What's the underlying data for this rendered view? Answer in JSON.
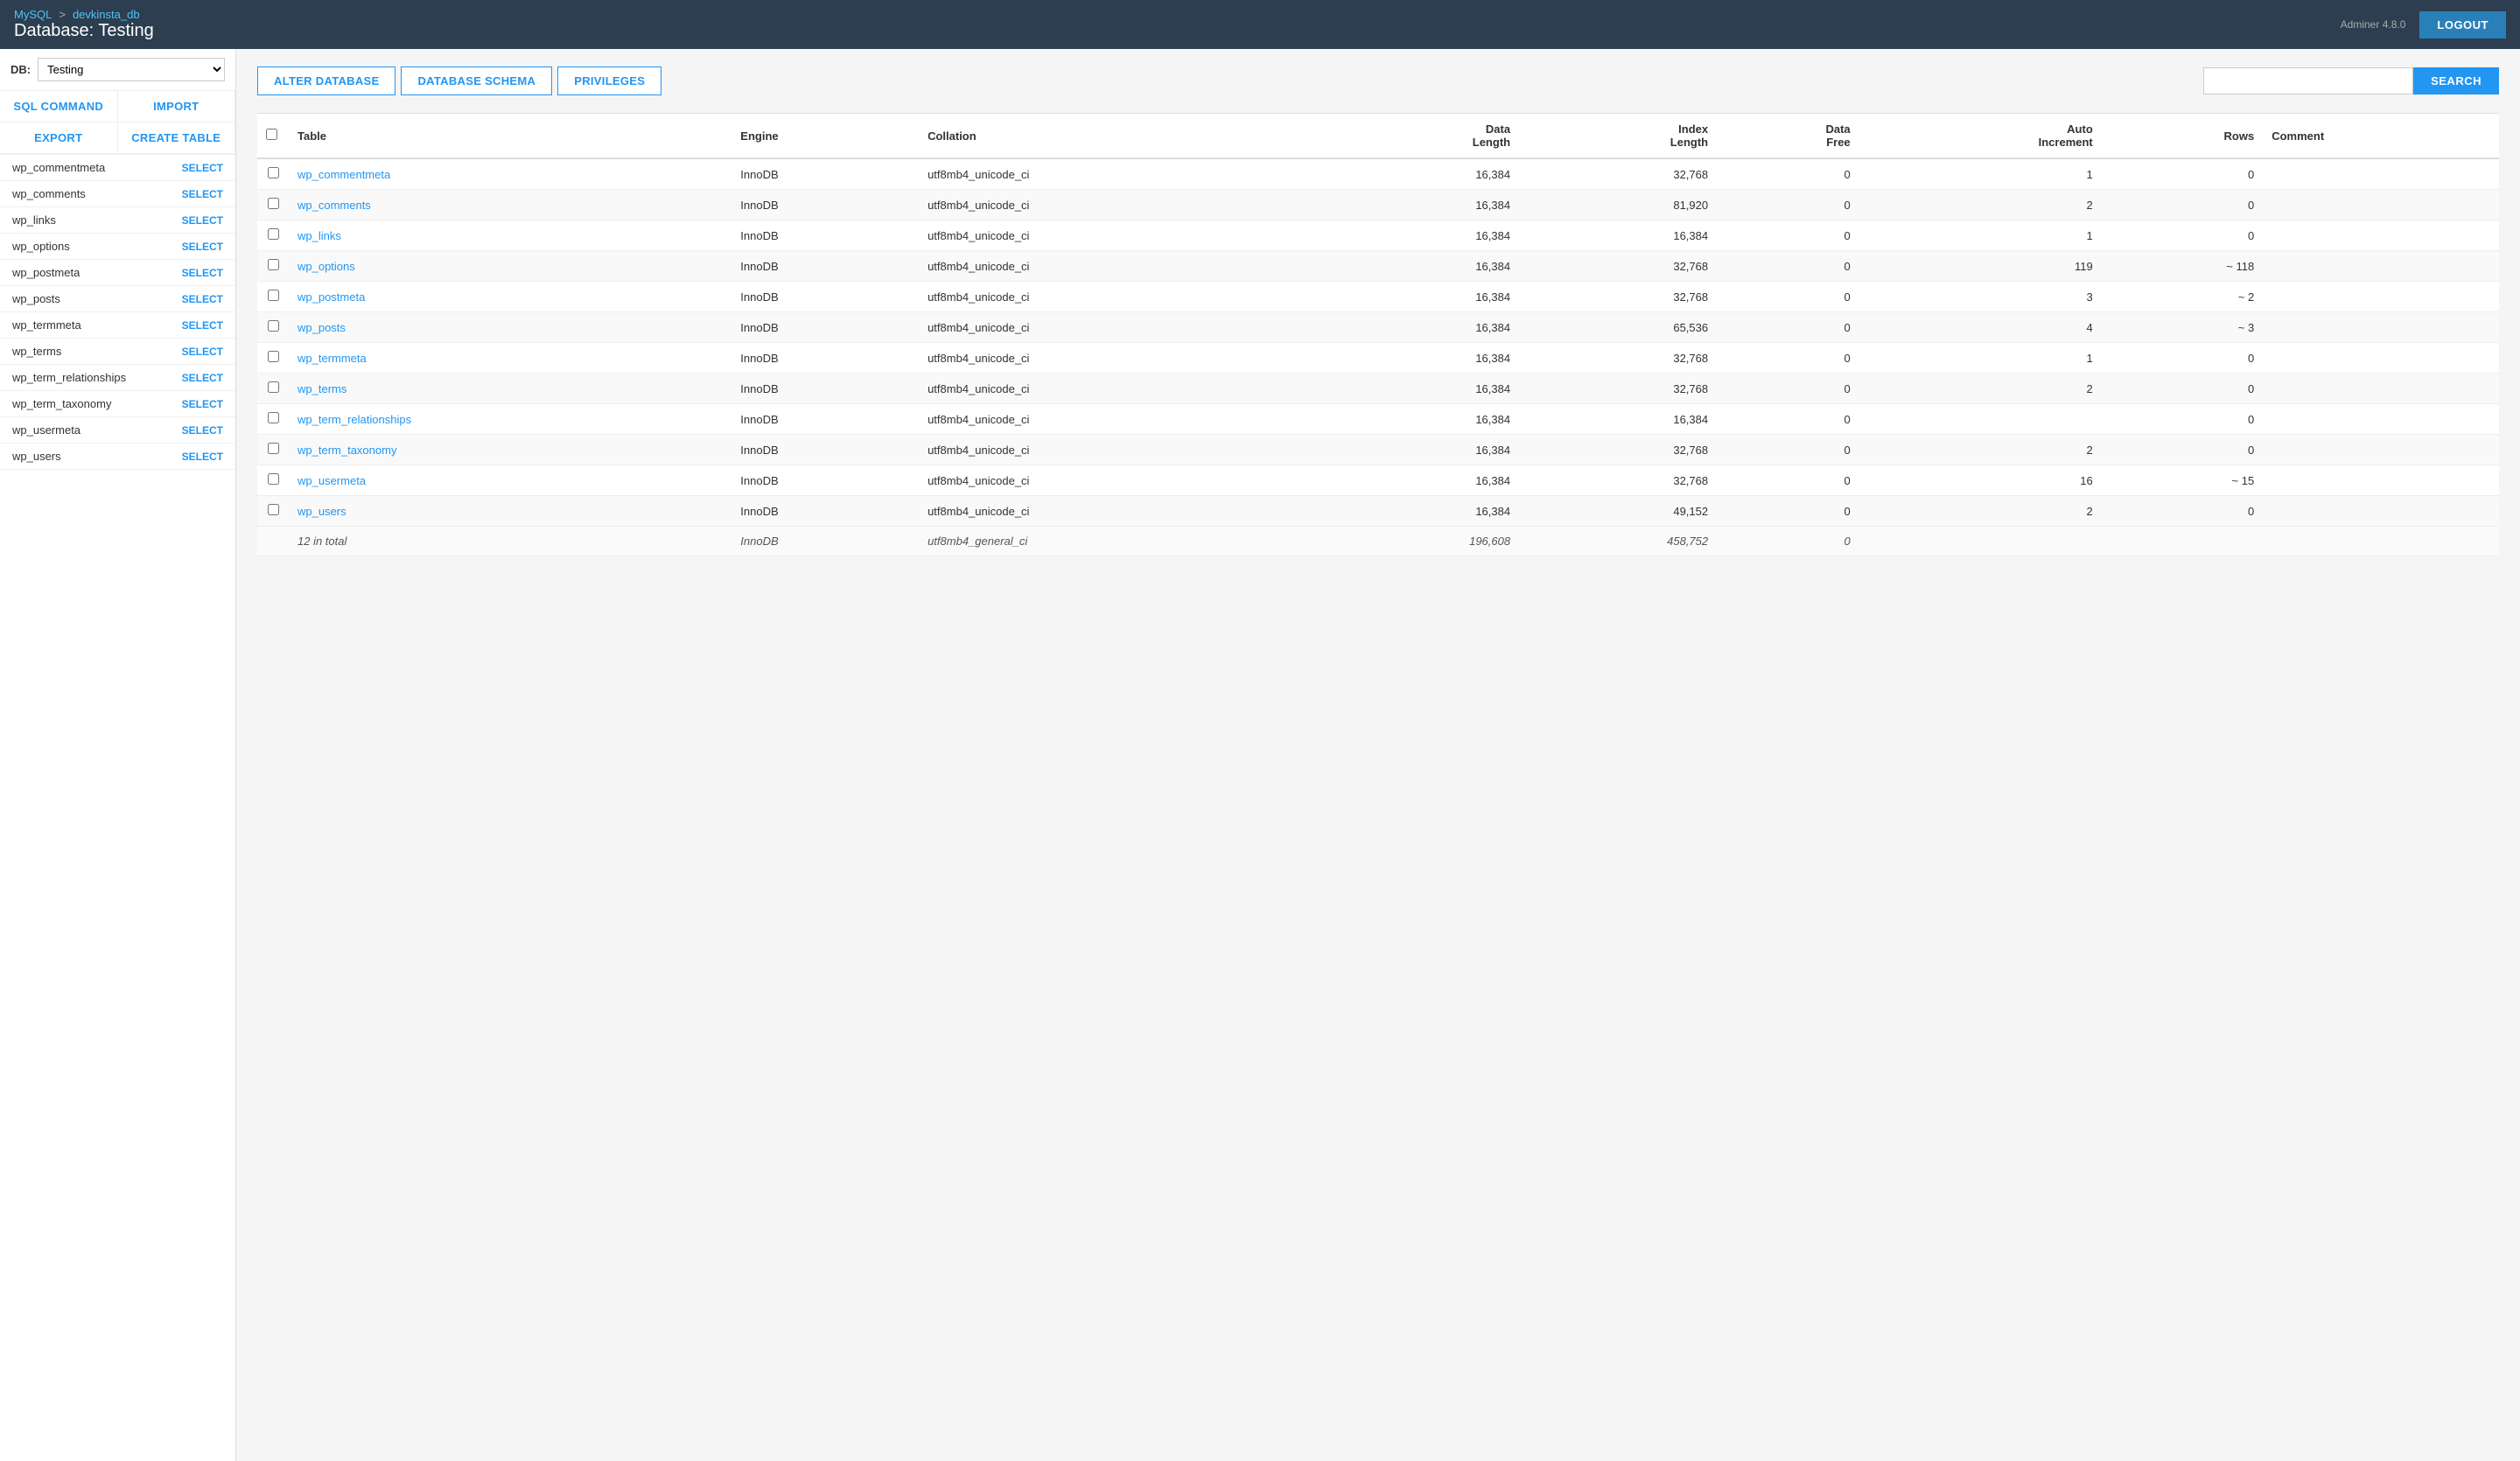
{
  "app": {
    "version_label": "Adminer",
    "version": "4.8.0",
    "logout_label": "LOGOUT"
  },
  "header": {
    "breadcrumb_mysql": "MySQL",
    "breadcrumb_db": "devkinsta_db",
    "db_title": "Database: Testing"
  },
  "sidebar": {
    "db_label": "DB:",
    "db_value": "Testing",
    "nav_buttons": [
      {
        "id": "sql-command",
        "label": "SQL COMMAND"
      },
      {
        "id": "import",
        "label": "IMPORT"
      },
      {
        "id": "export",
        "label": "EXPORT"
      },
      {
        "id": "create-table",
        "label": "CREATE TABLE"
      }
    ],
    "tables": [
      {
        "name": "wp_commentmeta",
        "select": "SELECT"
      },
      {
        "name": "wp_comments",
        "select": "SELECT"
      },
      {
        "name": "wp_links",
        "select": "SELECT"
      },
      {
        "name": "wp_options",
        "select": "SELECT"
      },
      {
        "name": "wp_postmeta",
        "select": "SELECT"
      },
      {
        "name": "wp_posts",
        "select": "SELECT"
      },
      {
        "name": "wp_termmeta",
        "select": "SELECT"
      },
      {
        "name": "wp_terms",
        "select": "SELECT"
      },
      {
        "name": "wp_term_relationships",
        "select": "SELECT"
      },
      {
        "name": "wp_term_taxonomy",
        "select": "SELECT"
      },
      {
        "name": "wp_usermeta",
        "select": "SELECT"
      },
      {
        "name": "wp_users",
        "select": "SELECT"
      }
    ]
  },
  "actions": {
    "alter_database": "ALTER DATABASE",
    "database_schema": "DATABASE SCHEMA",
    "privileges": "PRIVILEGES",
    "search_placeholder": "",
    "search_btn": "SEARCH"
  },
  "table": {
    "columns": [
      {
        "id": "checkbox",
        "label": ""
      },
      {
        "id": "table",
        "label": "Table"
      },
      {
        "id": "engine",
        "label": "Engine"
      },
      {
        "id": "collation",
        "label": "Collation"
      },
      {
        "id": "data_length",
        "label": "Data Length"
      },
      {
        "id": "index_length",
        "label": "Index Length"
      },
      {
        "id": "data_free",
        "label": "Data Free"
      },
      {
        "id": "auto_increment",
        "label": "Auto Increment"
      },
      {
        "id": "rows",
        "label": "Rows"
      },
      {
        "id": "comment",
        "label": "Comment"
      }
    ],
    "rows": [
      {
        "name": "wp_commentmeta",
        "engine": "InnoDB",
        "collation": "utf8mb4_unicode_ci",
        "data_length": "16,384",
        "index_length": "32,768",
        "data_free": "0",
        "auto_increment": "1",
        "rows": "0",
        "comment": ""
      },
      {
        "name": "wp_comments",
        "engine": "InnoDB",
        "collation": "utf8mb4_unicode_ci",
        "data_length": "16,384",
        "index_length": "81,920",
        "data_free": "0",
        "auto_increment": "2",
        "rows": "0",
        "comment": ""
      },
      {
        "name": "wp_links",
        "engine": "InnoDB",
        "collation": "utf8mb4_unicode_ci",
        "data_length": "16,384",
        "index_length": "16,384",
        "data_free": "0",
        "auto_increment": "1",
        "rows": "0",
        "comment": ""
      },
      {
        "name": "wp_options",
        "engine": "InnoDB",
        "collation": "utf8mb4_unicode_ci",
        "data_length": "16,384",
        "index_length": "32,768",
        "data_free": "0",
        "auto_increment": "119",
        "rows": "~ 118",
        "comment": ""
      },
      {
        "name": "wp_postmeta",
        "engine": "InnoDB",
        "collation": "utf8mb4_unicode_ci",
        "data_length": "16,384",
        "index_length": "32,768",
        "data_free": "0",
        "auto_increment": "3",
        "rows": "~ 2",
        "comment": ""
      },
      {
        "name": "wp_posts",
        "engine": "InnoDB",
        "collation": "utf8mb4_unicode_ci",
        "data_length": "16,384",
        "index_length": "65,536",
        "data_free": "0",
        "auto_increment": "4",
        "rows": "~ 3",
        "comment": ""
      },
      {
        "name": "wp_termmeta",
        "engine": "InnoDB",
        "collation": "utf8mb4_unicode_ci",
        "data_length": "16,384",
        "index_length": "32,768",
        "data_free": "0",
        "auto_increment": "1",
        "rows": "0",
        "comment": ""
      },
      {
        "name": "wp_terms",
        "engine": "InnoDB",
        "collation": "utf8mb4_unicode_ci",
        "data_length": "16,384",
        "index_length": "32,768",
        "data_free": "0",
        "auto_increment": "2",
        "rows": "0",
        "comment": ""
      },
      {
        "name": "wp_term_relationships",
        "engine": "InnoDB",
        "collation": "utf8mb4_unicode_ci",
        "data_length": "16,384",
        "index_length": "16,384",
        "data_free": "0",
        "auto_increment": "",
        "rows": "0",
        "comment": ""
      },
      {
        "name": "wp_term_taxonomy",
        "engine": "InnoDB",
        "collation": "utf8mb4_unicode_ci",
        "data_length": "16,384",
        "index_length": "32,768",
        "data_free": "0",
        "auto_increment": "2",
        "rows": "0",
        "comment": ""
      },
      {
        "name": "wp_usermeta",
        "engine": "InnoDB",
        "collation": "utf8mb4_unicode_ci",
        "data_length": "16,384",
        "index_length": "32,768",
        "data_free": "0",
        "auto_increment": "16",
        "rows": "~ 15",
        "comment": ""
      },
      {
        "name": "wp_users",
        "engine": "InnoDB",
        "collation": "utf8mb4_unicode_ci",
        "data_length": "16,384",
        "index_length": "49,152",
        "data_free": "0",
        "auto_increment": "2",
        "rows": "0",
        "comment": ""
      }
    ],
    "total": {
      "label": "12 in total",
      "engine": "InnoDB",
      "collation": "utf8mb4_general_ci",
      "data_length": "196,608",
      "index_length": "458,752",
      "data_free": "0"
    }
  }
}
